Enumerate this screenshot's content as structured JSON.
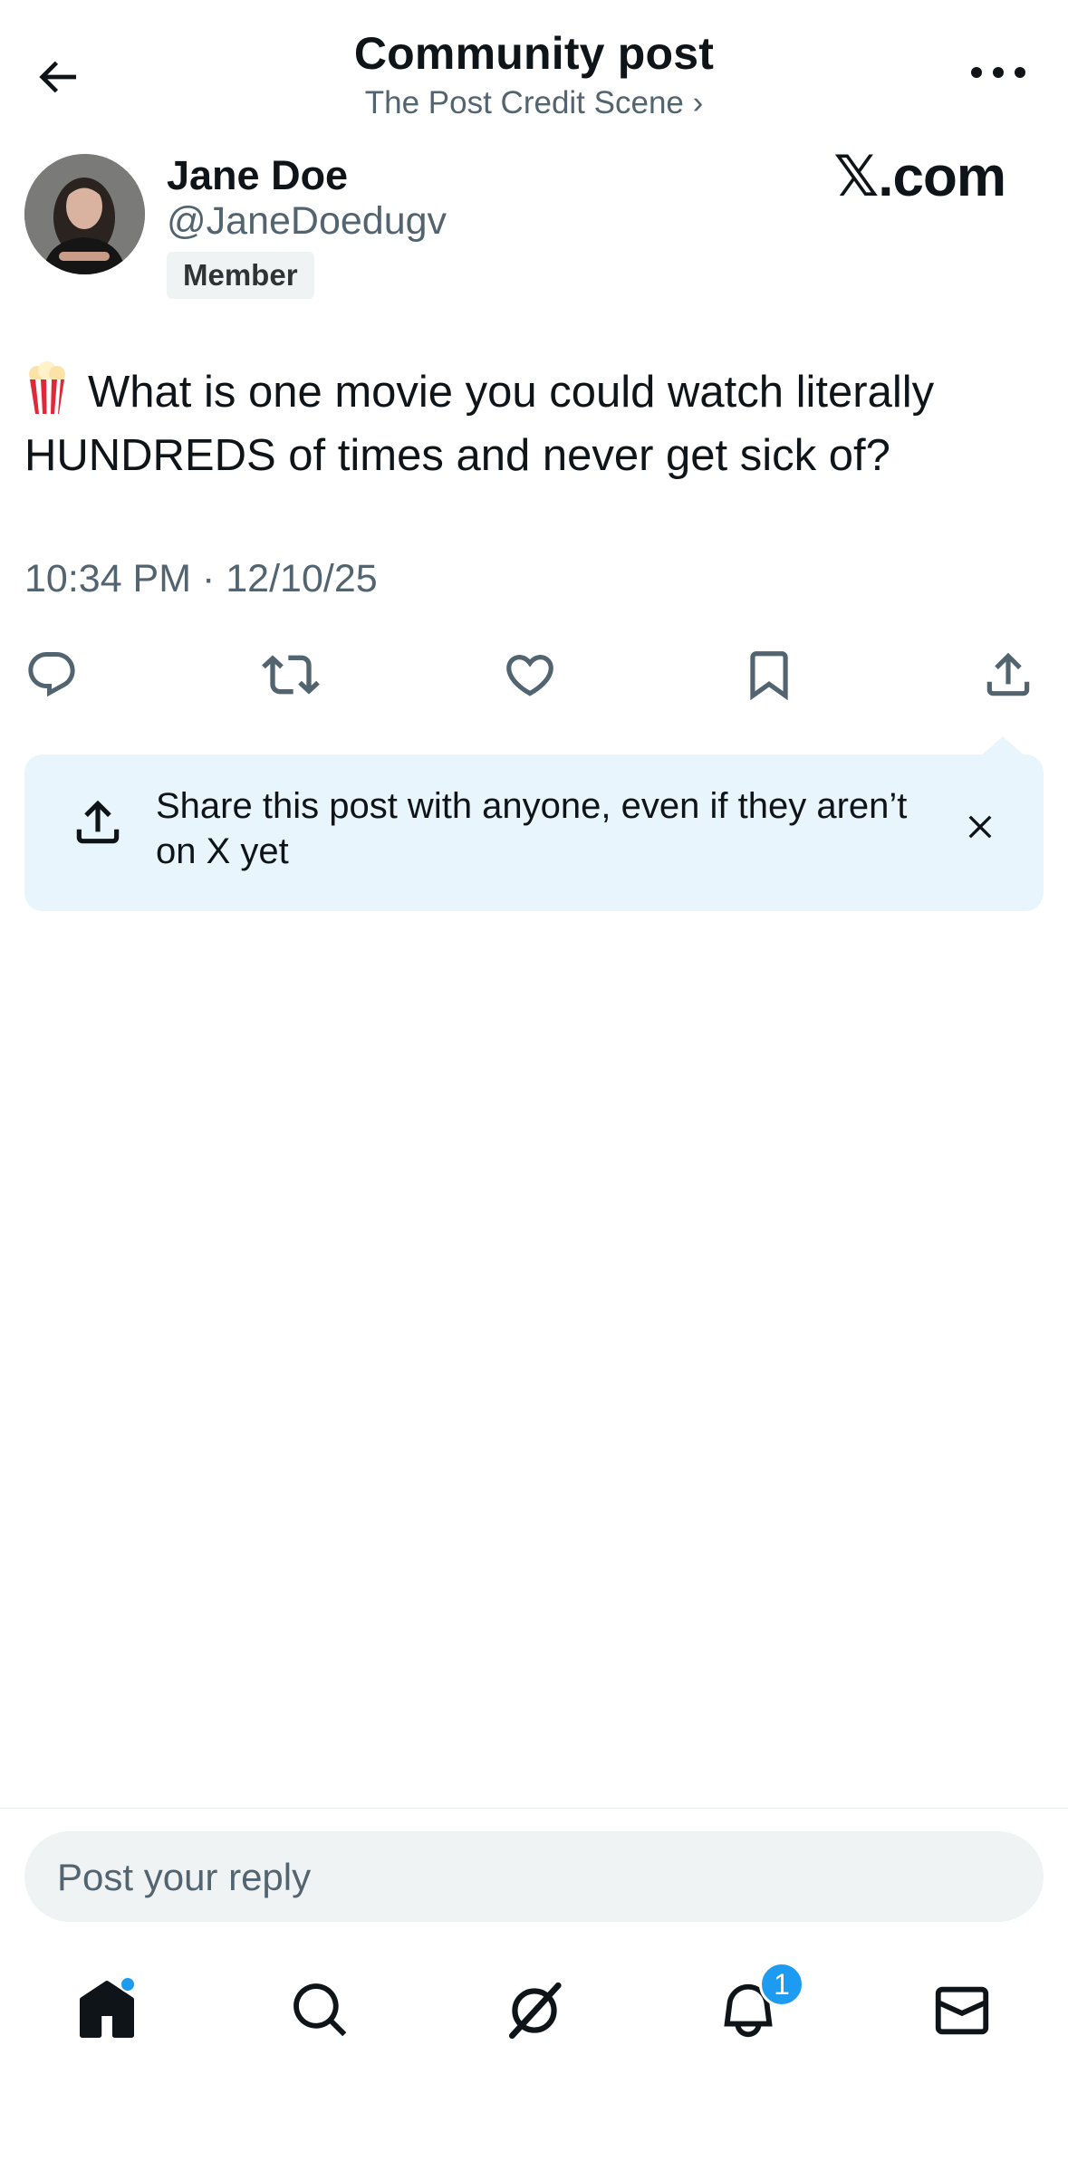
{
  "header": {
    "title": "Community post",
    "subtitle": "The Post Credit Scene ›"
  },
  "author": {
    "name": "Jane Doe",
    "handle": "@JaneDoedugv",
    "badge": "Member",
    "watermark": "𝕏.com"
  },
  "post": {
    "emoji": "popcorn",
    "text": "What is one movie you could watch literally HUNDREDS of times and never get sick of?",
    "timestamp": "10:34 PM · 12/10/25"
  },
  "share_tip": {
    "text": "Share this post with anyone, even if they aren’t on X yet"
  },
  "reply": {
    "placeholder": "Post your reply"
  },
  "nav": {
    "notifications_count": "1"
  },
  "colors": {
    "accent": "#1d9bf0",
    "text_primary": "#0f1419",
    "text_secondary": "#536471",
    "tip_background": "#e8f5fd"
  },
  "icons": [
    "back-arrow-icon",
    "more-icon",
    "reply-icon",
    "repost-icon",
    "like-icon",
    "bookmark-icon",
    "share-icon",
    "close-icon",
    "home-icon",
    "search-icon",
    "grok-icon",
    "bell-icon",
    "mail-icon"
  ]
}
